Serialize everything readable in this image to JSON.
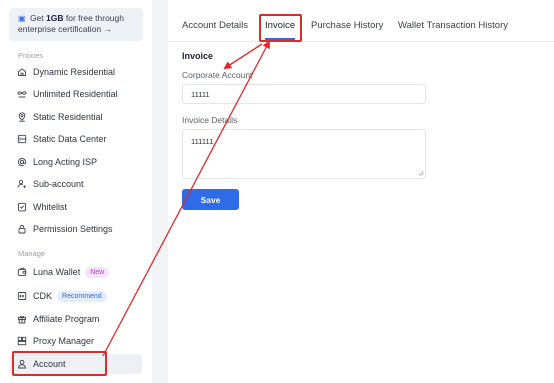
{
  "sidebar": {
    "promo": {
      "prefix": "Get",
      "highlight": "1GB",
      "rest": "for free through",
      "line2": "enterprise certification →"
    },
    "proxies_label": "Proxies",
    "manage_label": "Manage",
    "items": [
      {
        "label": "Dynamic Residential",
        "icon": "home-icon"
      },
      {
        "label": "Unlimited Residential",
        "icon": "infinity-icon"
      },
      {
        "label": "Static Residential",
        "icon": "location-pin-icon"
      },
      {
        "label": "Static Data Center",
        "icon": "server-icon"
      },
      {
        "label": "Long Acting ISP",
        "icon": "at-sign-icon"
      },
      {
        "label": "Sub-account",
        "icon": "user-plus-icon"
      },
      {
        "label": "Whitelist",
        "icon": "checklist-icon"
      },
      {
        "label": "Permission Settings",
        "icon": "lock-icon"
      },
      {
        "label": "Luna Wallet",
        "icon": "wallet-icon",
        "badge": "New"
      },
      {
        "label": "CDK",
        "icon": "cdk-icon",
        "badge": "Recommend"
      },
      {
        "label": "Affiliate Program",
        "icon": "gift-icon"
      },
      {
        "label": "Proxy Manager",
        "icon": "proxy-manager-icon"
      },
      {
        "label": "Account",
        "icon": "user-icon",
        "active": true
      }
    ]
  },
  "tabs": [
    {
      "label": "Account Details"
    },
    {
      "label": "Invoice",
      "active": true
    },
    {
      "label": "Purchase History"
    },
    {
      "label": "Wallet Transaction History"
    }
  ],
  "form": {
    "title": "Invoice",
    "corporate_account_label": "Corporate Account",
    "corporate_account_value": "11111",
    "invoice_details_label": "Invoice Details",
    "invoice_details_value": "111111",
    "save_label": "Save"
  },
  "colors": {
    "accent": "#2f6be6",
    "highlight": "#e02a2a",
    "new_badge": "#b33cd6"
  }
}
